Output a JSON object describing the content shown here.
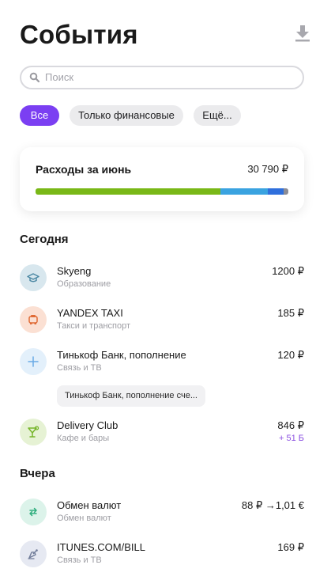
{
  "header": {
    "title": "События",
    "download_icon": "download-icon"
  },
  "search": {
    "placeholder": "Поиск"
  },
  "filters": [
    {
      "label": "Все",
      "active": true
    },
    {
      "label": "Только финансовые",
      "active": false
    },
    {
      "label": "Ещё...",
      "active": false
    }
  ],
  "summary": {
    "title": "Расходы за июнь",
    "amount": "30 790 ₽",
    "bar": [
      {
        "fraction": 0.73,
        "color": "#79b817"
      },
      {
        "fraction": 0.19,
        "color": "#3aa3e0"
      },
      {
        "fraction": 0.06,
        "color": "#2f6fdc"
      },
      {
        "fraction": 0.02,
        "color": "#8c8c95"
      }
    ]
  },
  "sections": {
    "today": "Сегодня",
    "yesterday": "Вчера"
  },
  "transactions": [
    {
      "name": "Skyeng",
      "category": "Образование",
      "amount": "1200 ₽",
      "icon": "graduation-cap-icon",
      "icon_bg": "#d8e7ee",
      "icon_color": "#4a87a3"
    },
    {
      "name": "YANDEX TAXI",
      "category": "Такси и транспорт",
      "amount": "185 ₽",
      "icon": "taxi-icon",
      "icon_bg": "#fbe0d3",
      "icon_color": "#e06a35"
    },
    {
      "name": "Тинькоф Банк, пополнение",
      "category": "Связь и ТВ",
      "amount": "120 ₽",
      "icon": "plus-icon",
      "icon_bg": "#e3f0fb",
      "icon_color": "#6aaae6",
      "note": "Тинькоф Банк, пополнение сче..."
    },
    {
      "name": "Delivery Club",
      "category": "Кафе и бары",
      "amount": "846 ₽",
      "bonus": "+ 51 Б",
      "icon": "cocktail-icon",
      "icon_bg": "#e6f2d4",
      "icon_color": "#76b52a"
    },
    {
      "name": "Обмен валют",
      "category": "Обмен валют",
      "amount": "88 ₽ →1,01 €",
      "icon": "exchange-icon",
      "icon_bg": "#dcf3ea",
      "icon_color": "#2fae7e"
    },
    {
      "name": "ITUNES.COM/BILL",
      "category": "Связь и ТВ",
      "amount": "169 ₽",
      "icon": "satellite-icon",
      "icon_bg": "#e6e9f2",
      "icon_color": "#6f7b98"
    }
  ]
}
